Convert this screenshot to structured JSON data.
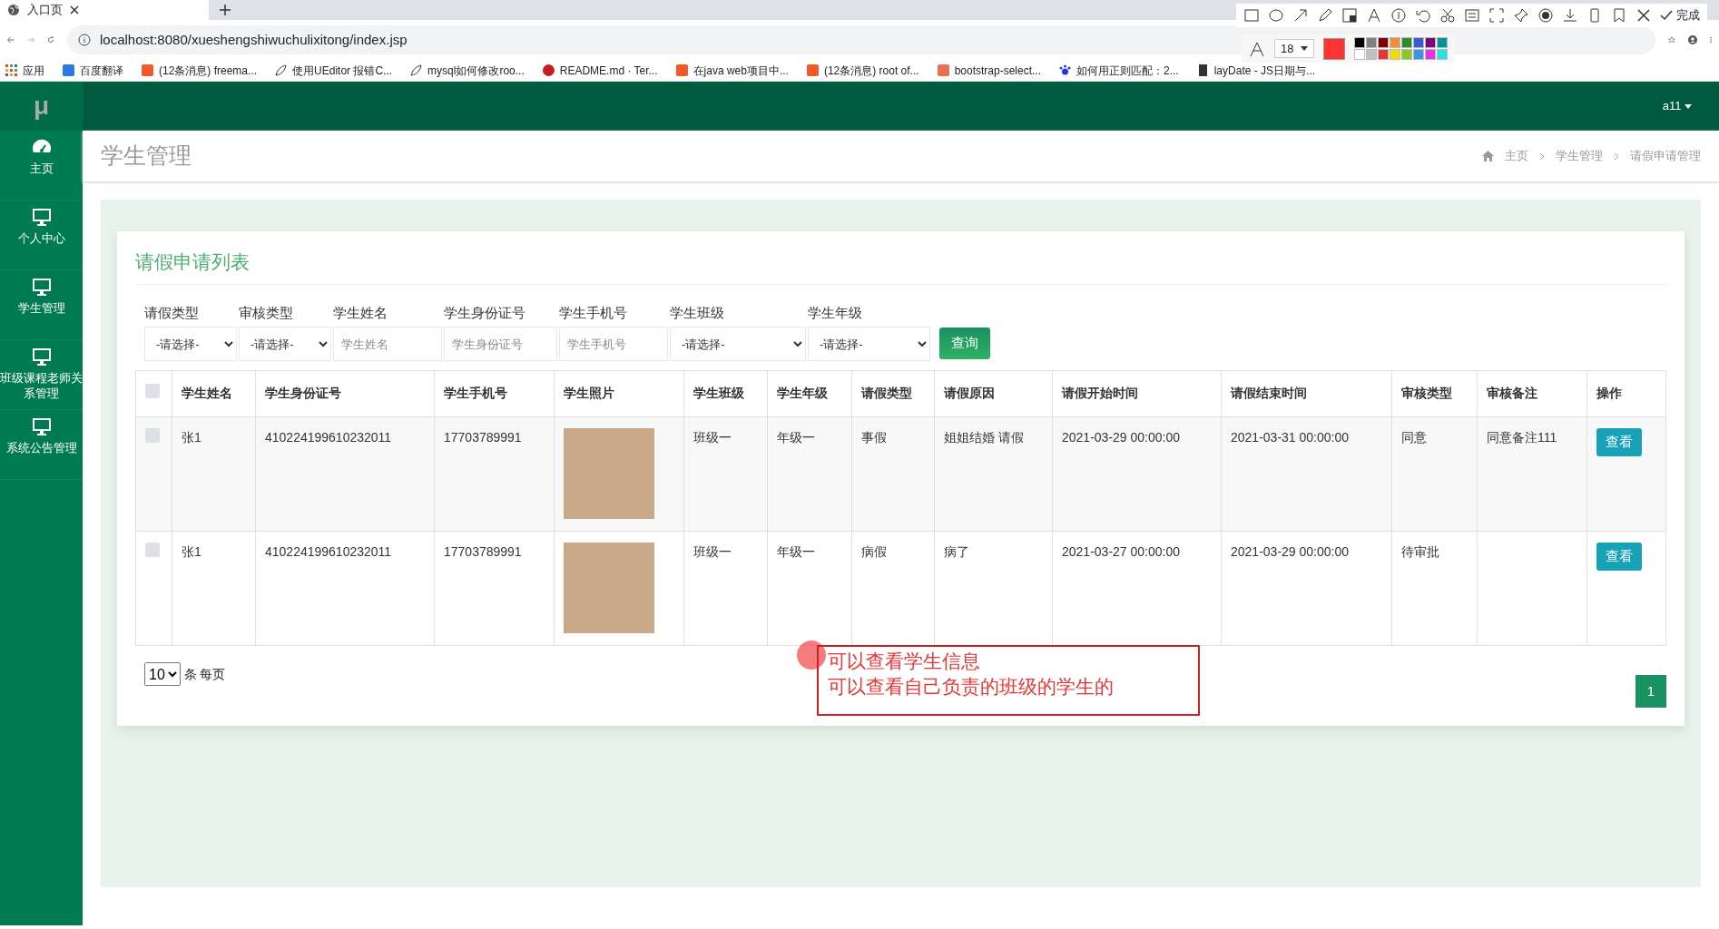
{
  "browser": {
    "tab_title": "入口页",
    "url": "localhost:8080/xueshengshiwuchulixitong/index.jsp",
    "bookmarks": [
      {
        "label": "应用",
        "kind": "apps"
      },
      {
        "label": "百度翻译",
        "kind": "translate"
      },
      {
        "label": "(12条消息) freema...",
        "kind": "csdn"
      },
      {
        "label": "使用UEditor 报错C...",
        "kind": "leaf"
      },
      {
        "label": "mysql如何修改roo...",
        "kind": "leaf"
      },
      {
        "label": "README.md · Ter...",
        "kind": "gitee"
      },
      {
        "label": "在java web项目中...",
        "kind": "csdn"
      },
      {
        "label": "(12条消息) root of...",
        "kind": "csdn"
      },
      {
        "label": "bootstrap-select...",
        "kind": "jian"
      },
      {
        "label": "如何用正则匹配：2...",
        "kind": "paw"
      },
      {
        "label": "layDate - JS日期与...",
        "kind": "doc"
      }
    ]
  },
  "capture_toolbar": {
    "done": "完成",
    "font_size": "18",
    "current_swatch": {
      "color": "#ff3333"
    },
    "palette": [
      {
        "color": "#000000"
      },
      {
        "color": "#808080"
      },
      {
        "color": "#800000"
      },
      {
        "color": "#f08c3c"
      },
      {
        "color": "#2e8b2e"
      },
      {
        "color": "#3c5ad2"
      },
      {
        "color": "#800080"
      },
      {
        "color": "#009696"
      },
      {
        "color": "#ffffff"
      },
      {
        "color": "#c0c0c0"
      },
      {
        "color": "#ee3333"
      },
      {
        "color": "#f0e000"
      },
      {
        "color": "#8cc81e"
      },
      {
        "color": "#3c96e6"
      },
      {
        "color": "#e632e6"
      },
      {
        "color": "#1ee6e6"
      }
    ]
  },
  "app": {
    "logo": "μ",
    "user": "a11",
    "sidebar": [
      {
        "label": "主页",
        "kind": "gauge"
      },
      {
        "label": "个人中心",
        "kind": "monitor"
      },
      {
        "label": "学生管理",
        "kind": "monitor"
      },
      {
        "label": "班级课程老师关系管理",
        "kind": "monitor"
      },
      {
        "label": "系统公告管理",
        "kind": "monitor"
      }
    ],
    "page_title": "学生管理",
    "breadcrumb": [
      "主页",
      "学生管理",
      "请假申请管理"
    ],
    "card_title": "请假申请列表",
    "filters": [
      {
        "label": "请假类型",
        "kind": "select",
        "value": "-请选择-"
      },
      {
        "label": "审核类型",
        "kind": "select",
        "value": "-请选择-"
      },
      {
        "label": "学生姓名",
        "kind": "text",
        "placeholder": "学生姓名"
      },
      {
        "label": "学生身份证号",
        "kind": "text",
        "placeholder": "学生身份证号"
      },
      {
        "label": "学生手机号",
        "kind": "text",
        "placeholder": "学生手机号"
      },
      {
        "label": "学生班级",
        "kind": "select",
        "value": "-请选择-"
      },
      {
        "label": "学生年级",
        "kind": "select",
        "value": "-请选择-"
      }
    ],
    "search_button": "查询",
    "table": {
      "select_all_checked": false,
      "columns": [
        "学生姓名",
        "学生身份证号",
        "学生手机号",
        "学生照片",
        "学生班级",
        "学生年级",
        "请假类型",
        "请假原因",
        "请假开始时间",
        "请假结束时间",
        "审核类型",
        "审核备注",
        "操作"
      ],
      "rows": [
        {
          "checked": false,
          "cells": [
            "张1",
            "410224199610232011",
            "17703789991",
            "",
            "班级一",
            "年级一",
            "事假",
            "姐姐结婚 请假",
            "2021-03-29 00:00:00",
            "2021-03-31 00:00:00",
            "同意",
            "同意备注111"
          ],
          "action": "查看"
        },
        {
          "checked": false,
          "cells": [
            "张1",
            "410224199610232011",
            "17703789991",
            "",
            "班级一",
            "年级一",
            "病假",
            "病了",
            "2021-03-27 00:00:00",
            "2021-03-29 00:00:00",
            "待审批",
            ""
          ],
          "action": "查看"
        }
      ]
    },
    "page_size": "10",
    "page_size_label": "条 每页",
    "pages": [
      {
        "label": "1",
        "selected": true
      }
    ]
  },
  "annotation": {
    "lines": [
      "可以查看学生信息",
      "可以查看自己负责的班级的学生的"
    ]
  }
}
